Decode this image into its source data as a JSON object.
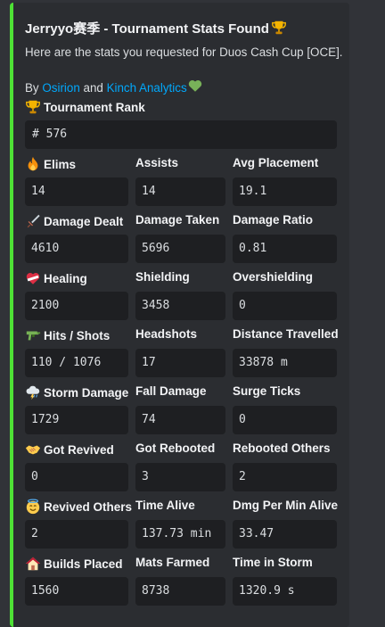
{
  "embed": {
    "accent_color": "#4ee135",
    "title": "Jerryyo赛季 - Tournament Stats Found",
    "title_icon": "trophy-icon",
    "description": "Here are the stats you requested for Duos Cash Cup [OCE].",
    "byline_prefix": "By ",
    "author_1": "Osirion",
    "byline_and": " and ",
    "author_2": "Kinch Analytics",
    "byline_icon": "green-heart-icon",
    "rank": {
      "label": "Tournament Rank",
      "icon": "trophy-icon",
      "value": "# 576"
    },
    "rows": [
      [
        {
          "label": "Elims",
          "icon": "fire-icon",
          "value": "14"
        },
        {
          "label": "Assists",
          "value": "14"
        },
        {
          "label": "Avg Placement",
          "value": "19.1"
        }
      ],
      [
        {
          "label": "Damage Dealt",
          "icon": "dagger-icon",
          "value": "4610"
        },
        {
          "label": "Damage Taken",
          "value": "5696"
        },
        {
          "label": "Damage Ratio",
          "value": "0.81"
        }
      ],
      [
        {
          "label": "Healing",
          "icon": "bandaged-heart-icon",
          "value": "2100"
        },
        {
          "label": "Shielding",
          "value": "3458"
        },
        {
          "label": "Overshielding",
          "value": "0"
        }
      ],
      [
        {
          "label": "Hits / Shots",
          "icon": "water-pistol-icon",
          "value": "110 / 1076"
        },
        {
          "label": "Headshots",
          "value": "17"
        },
        {
          "label": "Distance Travelled",
          "value": "33878 m"
        }
      ],
      [
        {
          "label": "Storm Damage",
          "icon": "storm-cloud-icon",
          "value": "1729"
        },
        {
          "label": "Fall Damage",
          "value": "74"
        },
        {
          "label": "Surge Ticks",
          "value": "0"
        }
      ],
      [
        {
          "label": "Got Revived",
          "icon": "handshake-icon",
          "value": "0"
        },
        {
          "label": "Got Rebooted",
          "value": "3"
        },
        {
          "label": "Rebooted Others",
          "value": "2"
        }
      ],
      [
        {
          "label": "Revived Others",
          "icon": "angel-face-icon",
          "value": "2"
        },
        {
          "label": "Time Alive",
          "value": "137.73 min"
        },
        {
          "label": "Dmg Per Min Alive",
          "value": "33.47"
        }
      ],
      [
        {
          "label": "Builds Placed",
          "icon": "house-icon",
          "value": "1560"
        },
        {
          "label": "Mats Farmed",
          "value": "8738"
        },
        {
          "label": "Time in Storm",
          "value": "1320.9 s"
        }
      ]
    ]
  }
}
